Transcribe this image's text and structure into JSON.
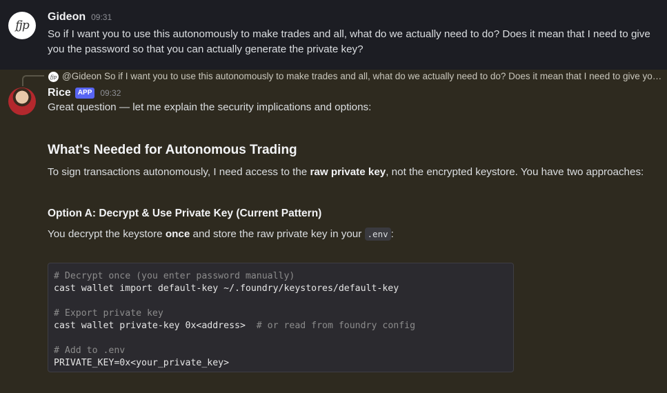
{
  "message1": {
    "author": "Gideon",
    "time": "09:31",
    "avatar_text": "fjp",
    "text": "So if I want you to use this autonomously to make trades and all, what do we actually need to do? Does it mean that I need to give you the password so that you can actually generate the private key?"
  },
  "reply_preview": {
    "mention": "@Gideon",
    "text": "So if I want you to use this autonomously to make trades and all, what do we actually need to do? Does it mean that I need to give you…"
  },
  "message2": {
    "author": "Rice",
    "badge": "APP",
    "time": "09:32",
    "intro": "Great question — let me explain the security implications and options:",
    "heading": "What's Needed for Autonomous Trading",
    "p1_before": "To sign transactions autonomously, I need access to the ",
    "p1_bold": "raw private key",
    "p1_after": ", not the encrypted keystore. You have two approaches:",
    "subheading": "Option A: Decrypt & Use Private Key (Current Pattern)",
    "p2_before": "You decrypt the keystore ",
    "p2_bold": "once",
    "p2_middle": " and store the raw private key in your ",
    "p2_code": ".env",
    "p2_after": ":",
    "code": {
      "c1": "# Decrypt once (you enter password manually)",
      "l1": "cast wallet import default-key ~/.foundry/keystores/default-key",
      "c2": "# Export private key",
      "l2": "cast wallet private-key 0x<address>  ",
      "l2_comment": "# or read from foundry config",
      "c3": "# Add to .env",
      "l3": "PRIVATE_KEY=0x<your_private_key>"
    }
  }
}
